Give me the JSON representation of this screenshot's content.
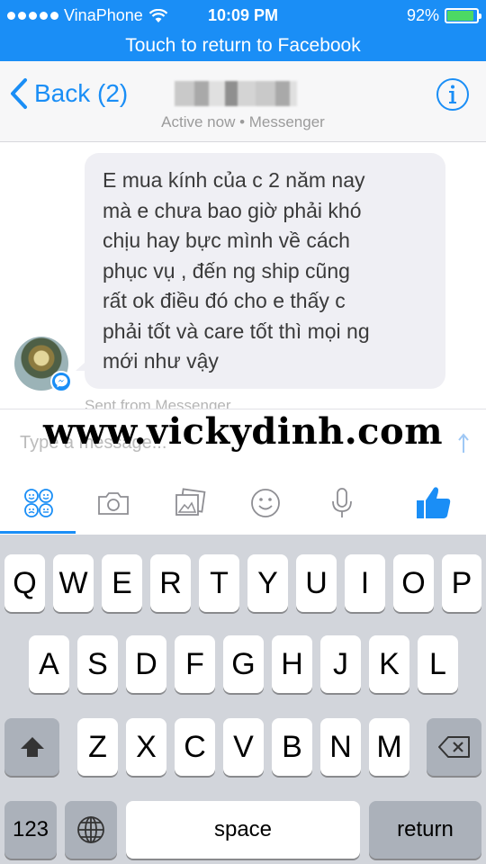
{
  "status_bar": {
    "carrier": "VinaPhone",
    "time": "10:09 PM",
    "battery": "92%",
    "battery_level": 0.92
  },
  "banner": {
    "text": "Touch to return to Facebook"
  },
  "header": {
    "back_label": "Back (2)",
    "presence": "Active now • Messenger",
    "icons": {
      "back": "chevron-left-icon",
      "info": "info-icon"
    }
  },
  "conversation": {
    "message_lines": [
      "E mua kính của c 2 năm nay",
      "mà e chưa bao giờ phải khó",
      "chịu hay bực mình về cách",
      "phục vụ , đến ng ship cũng",
      "rất ok điều đó cho e thấy c",
      "phải tốt và care tốt thì mọi ng",
      "mới như vậy"
    ],
    "sent_from": "Sent from Messenger"
  },
  "composer": {
    "placeholder": "Type a message...",
    "watermark": "www.vickydinh.com",
    "tools": [
      {
        "name": "stickers-icon"
      },
      {
        "name": "camera-icon"
      },
      {
        "name": "photos-icon"
      },
      {
        "name": "emoji-icon"
      },
      {
        "name": "microphone-icon"
      },
      {
        "name": "like-icon"
      }
    ]
  },
  "keyboard": {
    "row1": [
      "Q",
      "W",
      "E",
      "R",
      "T",
      "Y",
      "U",
      "I",
      "O",
      "P"
    ],
    "row2": [
      "A",
      "S",
      "D",
      "F",
      "G",
      "H",
      "J",
      "K",
      "L"
    ],
    "row3": [
      "Z",
      "X",
      "C",
      "V",
      "B",
      "N",
      "M"
    ],
    "numbers_label": "123",
    "space_label": "space",
    "return_label": "return",
    "icons": {
      "shift": "shift-icon",
      "delete": "delete-icon",
      "globe": "globe-icon"
    }
  },
  "colors": {
    "accent": "#1a8ef6",
    "bubble": "#efeff4",
    "keyboard_bg": "#d2d5db",
    "battery_fill": "#4cd964"
  }
}
